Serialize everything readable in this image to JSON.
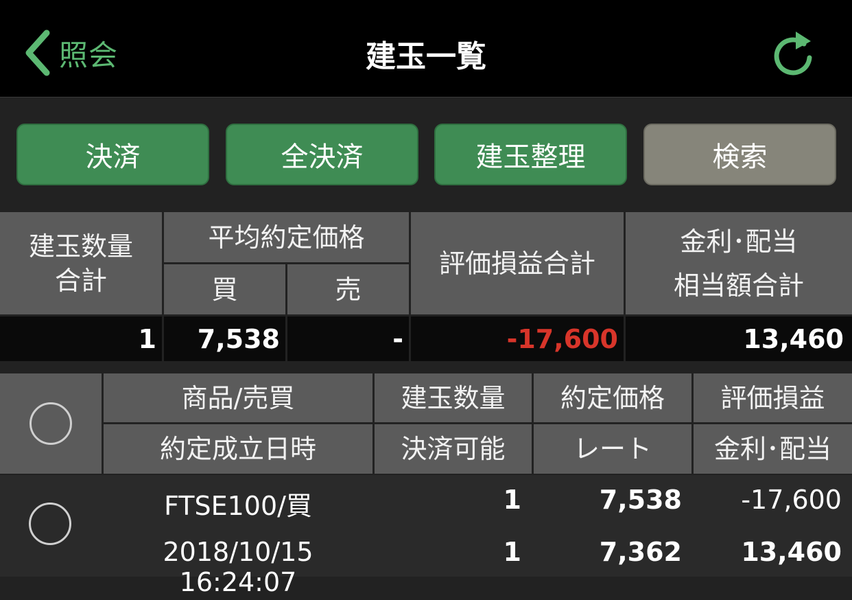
{
  "nav": {
    "back_label": "照会",
    "title": "建玉一覧"
  },
  "actions": {
    "settle": "決済",
    "settle_all": "全決済",
    "organize": "建玉整理",
    "search": "検索"
  },
  "summary": {
    "headers": {
      "quantity_total_line1": "建玉数量",
      "quantity_total_line2": "合計",
      "avg_price": "平均約定価格",
      "buy": "買",
      "sell": "売",
      "pl_total": "評価損益合計",
      "interest_line1": "金利･配当",
      "interest_line2": "相当額合計"
    },
    "values": {
      "quantity": "1",
      "buy": "7,538",
      "sell": "-",
      "pl_total": "-17,600",
      "interest": "13,460"
    }
  },
  "list": {
    "headers": {
      "product": "商品/売買",
      "date": "約定成立日時",
      "quantity": "建玉数量",
      "closable": "決済可能",
      "price": "約定価格",
      "rate": "レート",
      "pl": "評価損益",
      "interest": "金利･配当"
    },
    "rows": [
      {
        "product": "FTSE100/買",
        "date": "2018/10/15 16:24:07",
        "quantity": "1",
        "closable": "1",
        "price": "7,538",
        "rate": "7,362",
        "pl": "-17,600",
        "interest": "13,460"
      }
    ]
  },
  "colors": {
    "accent_green": "#5cb872",
    "button_green": "#3f8c54",
    "button_gray": "#86857a",
    "negative_red": "#d8352a"
  }
}
